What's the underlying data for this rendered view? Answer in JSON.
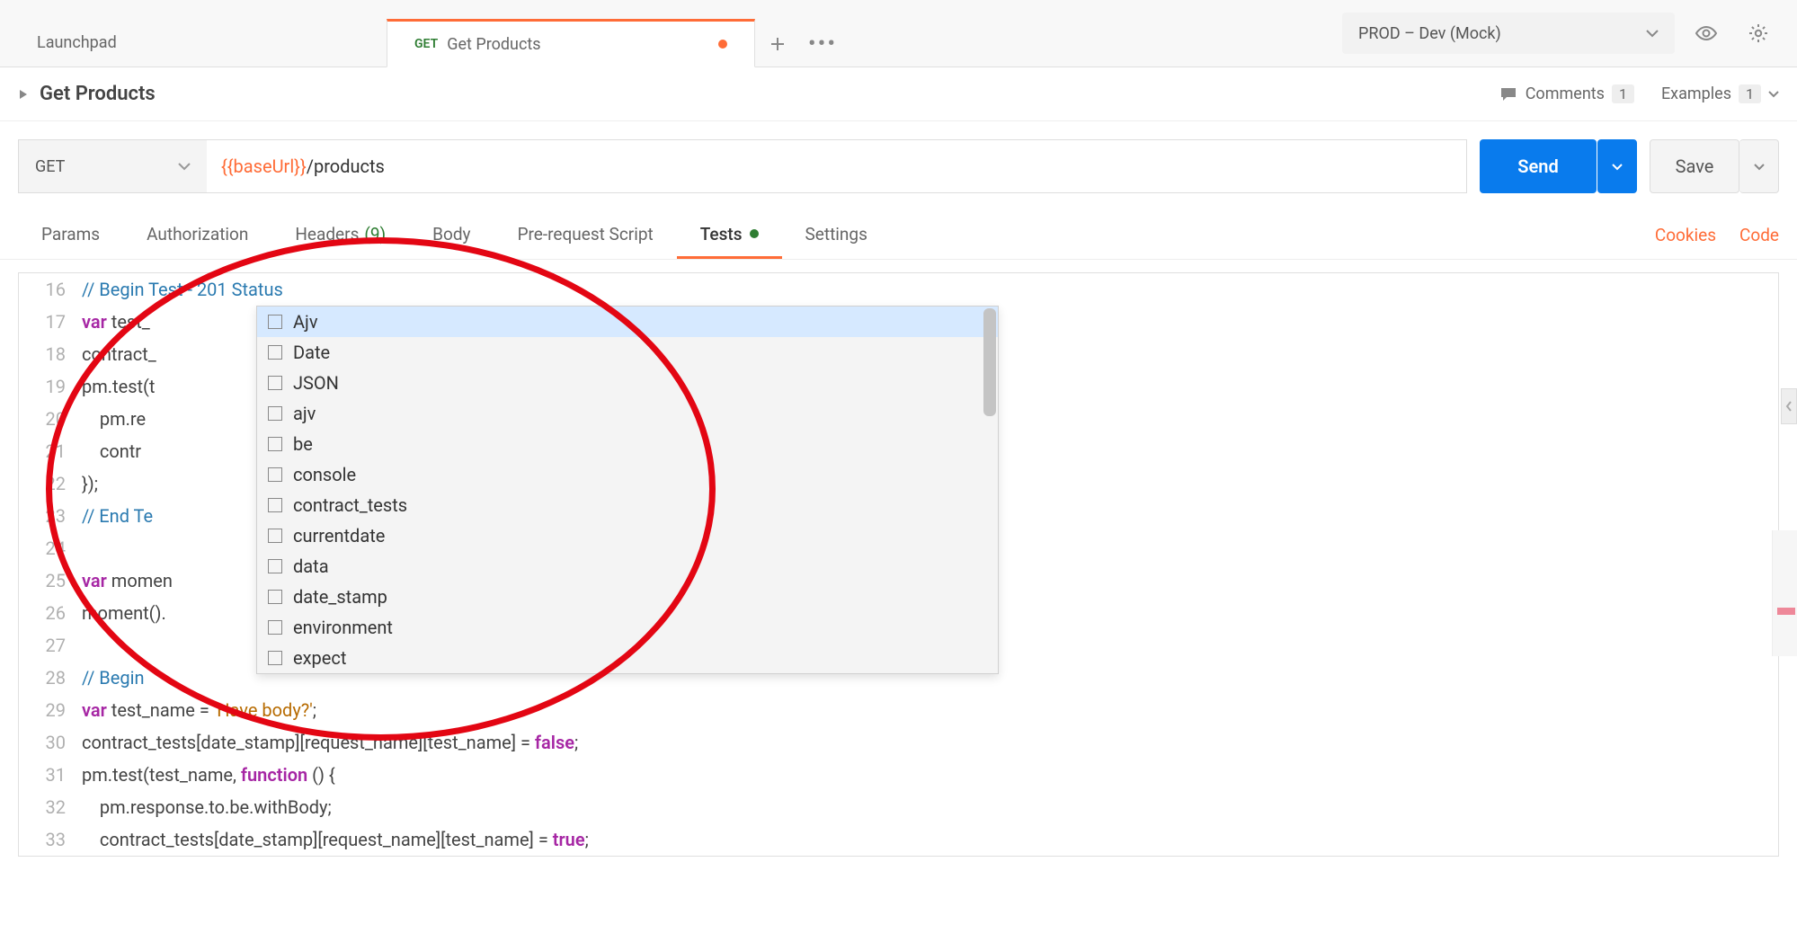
{
  "topbar": {
    "tab_launch": "Launchpad",
    "tab_active_method": "GET",
    "tab_active_label": "Get Products",
    "env_label": "PROD – Dev (Mock)"
  },
  "req_header": {
    "title": "Get Products",
    "comments_label": "Comments",
    "comments_count": "1",
    "examples_label": "Examples",
    "examples_count": "1"
  },
  "url_row": {
    "method": "GET",
    "url_var": "{{baseUrl}}",
    "url_path": "/products",
    "send": "Send",
    "save": "Save"
  },
  "subtabs": {
    "params": "Params",
    "auth": "Authorization",
    "headers": "Headers",
    "headers_count": "(9)",
    "body": "Body",
    "prereq": "Pre-request Script",
    "tests": "Tests",
    "settings": "Settings",
    "cookies": "Cookies",
    "code": "Code"
  },
  "autocomplete": [
    "Ajv",
    "Date",
    "JSON",
    "ajv",
    "be",
    "console",
    "contract_tests",
    "currentdate",
    "data",
    "date_stamp",
    "environment",
    "expect"
  ],
  "code_lines": [
    {
      "n": 16,
      "html": "<span class='cm-comment'>// Begin Test - 201 Status</span>"
    },
    {
      "n": 17,
      "html": "<span class='cm-kw'>var</span> test_"
    },
    {
      "n": 18,
      "html": "contract_"
    },
    {
      "n": 19,
      "html": "pm.test(t"
    },
    {
      "n": 20,
      "html": "    pm.re"
    },
    {
      "n": 21,
      "html": "    contr"
    },
    {
      "n": 22,
      "html": "});"
    },
    {
      "n": 23,
      "html": "<span class='cm-comment'>// End Te</span>"
    },
    {
      "n": 24,
      "html": ""
    },
    {
      "n": 25,
      "html": "<span class='cm-kw'>var</span> momen"
    },
    {
      "n": 26,
      "html": "moment()."
    },
    {
      "n": 27,
      "html": ""
    },
    {
      "n": 28,
      "html": "<span class='cm-comment'>// Begin </span>"
    },
    {
      "n": 29,
      "html": "<span class='cm-kw'>var</span> test_name = <span class='cm-str'>'Have body?'</span>;"
    },
    {
      "n": 30,
      "html": "contract_tests[date_stamp][request_name][test_name] = <span class='cm-bool'>false</span>;"
    },
    {
      "n": 31,
      "html": "pm.test(test_name, <span class='cm-kw'>function</span> () {"
    },
    {
      "n": 32,
      "html": "    pm.response.to.be.withBody;"
    },
    {
      "n": 33,
      "html": "    contract_tests[date_stamp][request_name][test_name] = <span class='cm-bool'>true</span>;"
    }
  ]
}
